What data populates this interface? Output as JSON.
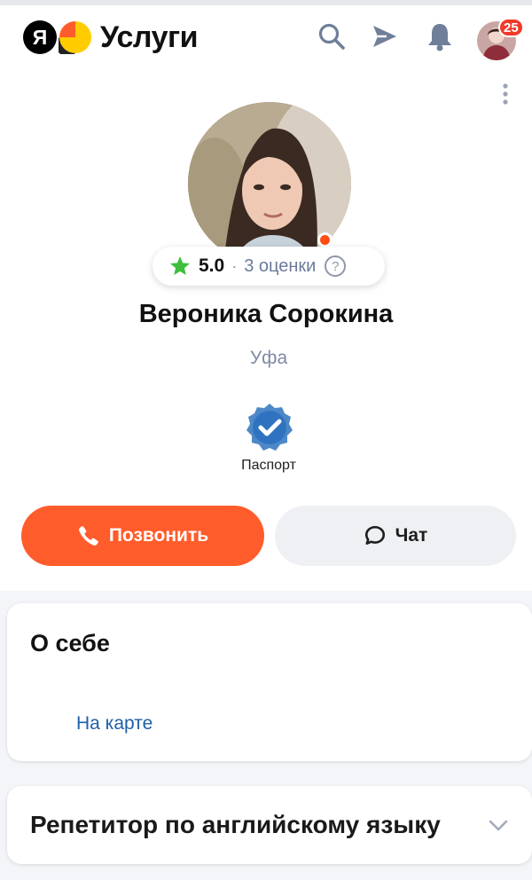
{
  "header": {
    "logo_letter": "Я",
    "logo_text": "Услуги",
    "icons": [
      "search-icon",
      "send-icon",
      "bell-icon"
    ],
    "notifications_count": "25"
  },
  "profile": {
    "rating": "5.0",
    "ratings_count": "3 оценки",
    "help": "?",
    "name": "Вероника Сорокина",
    "city": "Уфа",
    "verification_label": "Паспорт",
    "online": true
  },
  "actions": {
    "call_label": "Позвонить",
    "chat_label": "Чат"
  },
  "about": {
    "title": "О себе",
    "map_link": "На карте"
  },
  "service": {
    "title": "Репетитор по английскому языку"
  },
  "colors": {
    "accent": "#ff5c2b",
    "star": "#3dbf3d",
    "link": "#1f5fa8",
    "muted": "#7e8ba4"
  }
}
